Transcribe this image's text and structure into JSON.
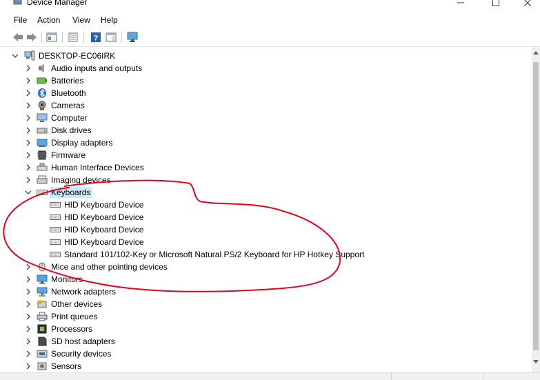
{
  "window": {
    "title": "Device Manager"
  },
  "menu": {
    "file": "File",
    "action": "Action",
    "view": "View",
    "help": "Help"
  },
  "tree": {
    "root": "DESKTOP-EC06IRK",
    "categories": [
      {
        "label": "Audio inputs and outputs",
        "icon": "speaker-icon"
      },
      {
        "label": "Batteries",
        "icon": "battery-icon"
      },
      {
        "label": "Bluetooth",
        "icon": "bluetooth-icon"
      },
      {
        "label": "Cameras",
        "icon": "camera-icon"
      },
      {
        "label": "Computer",
        "icon": "computer-icon"
      },
      {
        "label": "Disk drives",
        "icon": "disk-drive-icon"
      },
      {
        "label": "Display adapters",
        "icon": "display-adapter-icon"
      },
      {
        "label": "Firmware",
        "icon": "firmware-icon"
      },
      {
        "label": "Human Interface Devices",
        "icon": "hid-icon"
      },
      {
        "label": "Imaging devices",
        "icon": "imaging-icon"
      },
      {
        "label": "Keyboards",
        "icon": "keyboard-icon",
        "expanded": true,
        "selected": true
      },
      {
        "label": "Mice and other pointing devices",
        "icon": "mouse-icon"
      },
      {
        "label": "Monitors",
        "icon": "monitor-icon"
      },
      {
        "label": "Network adapters",
        "icon": "network-adapter-icon"
      },
      {
        "label": "Other devices",
        "icon": "unknown-device-icon"
      },
      {
        "label": "Print queues",
        "icon": "printer-icon"
      },
      {
        "label": "Processors",
        "icon": "processor-icon"
      },
      {
        "label": "SD host adapters",
        "icon": "sd-card-icon"
      },
      {
        "label": "Security devices",
        "icon": "security-icon"
      },
      {
        "label": "Sensors",
        "icon": "sensor-icon"
      }
    ],
    "keyboards": [
      "HID Keyboard Device",
      "HID Keyboard Device",
      "HID Keyboard Device",
      "HID Keyboard Device",
      "Standard 101/102-Key or Microsoft Natural PS/2 Keyboard for HP Hotkey Support"
    ]
  },
  "colors": {
    "selection": "#cce8ff",
    "annotation": "#e8001c"
  }
}
